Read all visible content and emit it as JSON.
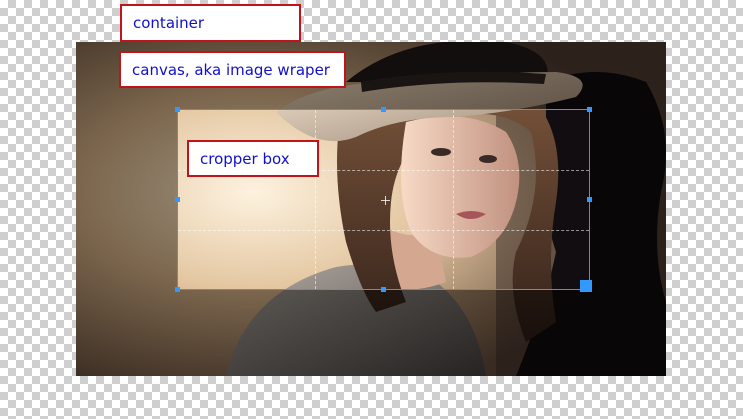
{
  "labels": {
    "container": "container",
    "canvas": "canvas, aka image wraper",
    "cropper_box": "cropper box"
  },
  "colors": {
    "label_border": "#c0141a",
    "label_text": "#1111cc",
    "cropper_accent": "#3399ff",
    "checker_light": "#ffffff",
    "checker_dark": "#cfcfcf"
  },
  "image": {
    "subject": "photo-of-woman-in-hat"
  }
}
